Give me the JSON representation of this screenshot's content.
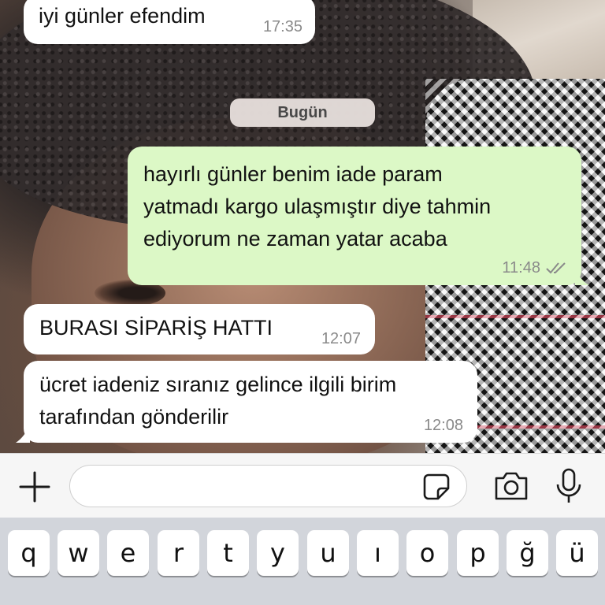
{
  "messages": [
    {
      "direction": "in",
      "text": "iyi günler efendim",
      "time": "17:35"
    },
    {
      "direction": "out",
      "text": "hayırlı günler benim iade param\nyatmadı kargo ulaşmıştır diye tahmin\nediyorum ne zaman yatar acaba",
      "time": "11:48",
      "status": "read-ticks"
    },
    {
      "direction": "in",
      "text": "BURASI SİPARİŞ HATTI",
      "time": "12:07"
    },
    {
      "direction": "in",
      "text": "ücret iadeniz sıranız gelince ilgili birim\ntarafından gönderilir",
      "time": "12:08"
    }
  ],
  "date_separator": "Bugün",
  "input_bar": {
    "placeholder": "",
    "icons": [
      "plus-icon",
      "sticker-icon",
      "camera-icon",
      "microphone-icon"
    ]
  },
  "keyboard": {
    "row1": [
      "q",
      "w",
      "e",
      "r",
      "t",
      "y",
      "u",
      "ı",
      "o",
      "p",
      "ğ",
      "ü"
    ]
  },
  "colors": {
    "incoming_bubble": "#ffffff",
    "outgoing_bubble": "#dcf8c6",
    "keyboard_bg": "#d2d5db",
    "input_bar_bg": "#f6f6f6"
  }
}
